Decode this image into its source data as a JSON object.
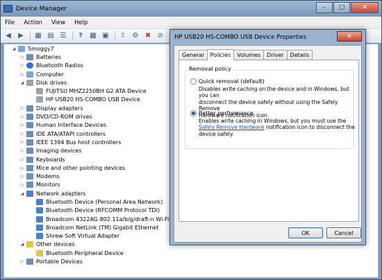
{
  "window": {
    "title": "Device Manager",
    "menu": [
      "File",
      "Action",
      "View",
      "Help"
    ]
  },
  "tree": {
    "root": "Smoggy7",
    "items": [
      {
        "label": "Batteries",
        "level": 1,
        "icon": "battery-icon",
        "expander": "collapsed"
      },
      {
        "label": "Bluetooth Radios",
        "level": 1,
        "icon": "bluetooth-icon",
        "expander": "collapsed"
      },
      {
        "label": "Computer",
        "level": 1,
        "icon": "computer-icon",
        "expander": "collapsed"
      },
      {
        "label": "Disk drives",
        "level": 1,
        "icon": "disk-icon",
        "expander": "expanded"
      },
      {
        "label": "FUJITSU MHZ2250BH G2 ATA Device",
        "level": 2,
        "icon": "disk-icon"
      },
      {
        "label": "HP USB20 HS-COMBO USB Device",
        "level": 2,
        "icon": "disk-icon"
      },
      {
        "label": "Display adapters",
        "level": 1,
        "icon": "display-icon",
        "expander": "collapsed"
      },
      {
        "label": "DVD/CD-ROM drives",
        "level": 1,
        "icon": "dvd-icon",
        "expander": "collapsed"
      },
      {
        "label": "Human Interface Devices",
        "level": 1,
        "icon": "hid-icon",
        "expander": "collapsed"
      },
      {
        "label": "IDE ATA/ATAPI controllers",
        "level": 1,
        "icon": "ide-icon",
        "expander": "collapsed"
      },
      {
        "label": "IEEE 1394 Bus host controllers",
        "level": 1,
        "icon": "firewire-icon",
        "expander": "collapsed"
      },
      {
        "label": "Imaging devices",
        "level": 1,
        "icon": "camera-icon",
        "expander": "collapsed"
      },
      {
        "label": "Keyboards",
        "level": 1,
        "icon": "keyboard-icon",
        "expander": "collapsed"
      },
      {
        "label": "Mice and other pointing devices",
        "level": 1,
        "icon": "mouse-icon",
        "expander": "collapsed"
      },
      {
        "label": "Modems",
        "level": 1,
        "icon": "modem-icon",
        "expander": "collapsed"
      },
      {
        "label": "Monitors",
        "level": 1,
        "icon": "monitor-icon",
        "expander": "collapsed"
      },
      {
        "label": "Network adapters",
        "level": 1,
        "icon": "network-icon",
        "expander": "expanded"
      },
      {
        "label": "Bluetooth Device (Personal Area Network)",
        "level": 2,
        "icon": "network-icon"
      },
      {
        "label": "Bluetooth Device (RFCOMM Protocol TDI)",
        "level": 2,
        "icon": "network-icon"
      },
      {
        "label": "Broadcom 4322AG 802.11a/b/g/draft-n Wi-Fi Ada",
        "level": 2,
        "icon": "network-icon"
      },
      {
        "label": "Broadcom NetLink (TM) Gigabit Ethernet",
        "level": 2,
        "icon": "network-icon"
      },
      {
        "label": "Shrew Soft Virtual Adapter",
        "level": 2,
        "icon": "network-icon"
      },
      {
        "label": "Other devices",
        "level": 1,
        "icon": "warning-icon",
        "expander": "expanded"
      },
      {
        "label": "Bluetooth Peripheral Device",
        "level": 2,
        "icon": "warning-icon"
      },
      {
        "label": "Portable Devices",
        "level": 1,
        "icon": "portable-icon",
        "expander": "collapsed"
      }
    ]
  },
  "dialog": {
    "title": "HP USB20 HS-COMBO USB Device Properties",
    "tabs": [
      "General",
      "Policies",
      "Volumes",
      "Driver",
      "Details"
    ],
    "active_tab": "Policies",
    "group_title": "Removal policy",
    "option1": {
      "label": "Quick removal (default)",
      "selected": false,
      "desc": [
        "Disables write caching on the device and in Windows, but you can",
        "disconnect the device safely without using the Safely Remove",
        "Hardware notification icon."
      ]
    },
    "option2": {
      "label": "Better performance",
      "selected": true,
      "desc_line1": "Enables write caching in Windows, but you must use the",
      "desc_link": "Safely Remove Hardware",
      "desc_line2_rest": " notification icon to disconnect the",
      "desc_line3": "device safely."
    },
    "ok_label": "OK",
    "cancel_label": "Cancel"
  }
}
